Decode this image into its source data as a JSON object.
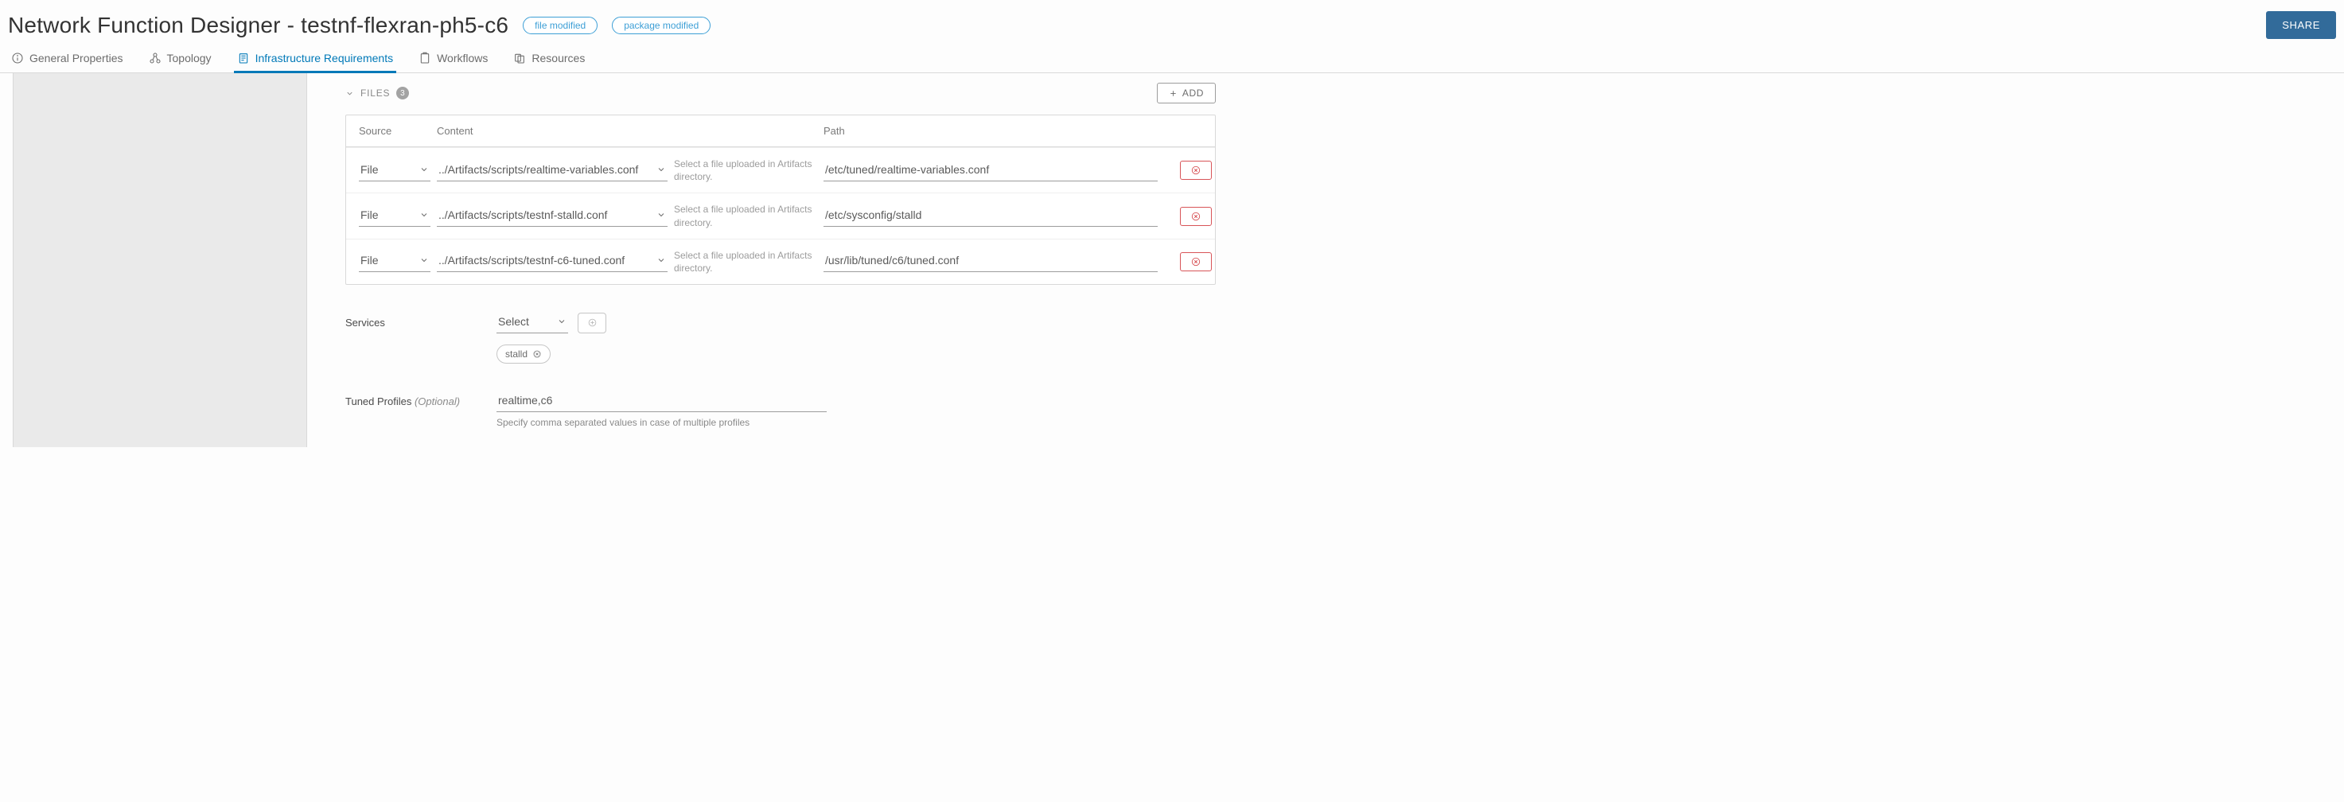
{
  "header": {
    "title": "Network Function Designer - testnf-flexran-ph5-c6",
    "badges": [
      "file modified",
      "package modified"
    ],
    "share_label": "SHARE"
  },
  "tabs": [
    {
      "label": "General Properties"
    },
    {
      "label": "Topology"
    },
    {
      "label": "Infrastructure Requirements"
    },
    {
      "label": "Workflows"
    },
    {
      "label": "Resources"
    }
  ],
  "files": {
    "section_label": "FILES",
    "count": "3",
    "add_label": "ADD",
    "columns": {
      "source": "Source",
      "content": "Content",
      "path": "Path"
    },
    "hint": "Select a file uploaded in Artifacts directory.",
    "rows": [
      {
        "source": "File",
        "content": "../Artifacts/scripts/realtime-variables.conf",
        "path": "/etc/tuned/realtime-variables.conf"
      },
      {
        "source": "File",
        "content": "../Artifacts/scripts/testnf-stalld.conf",
        "path": "/etc/sysconfig/stalld"
      },
      {
        "source": "File",
        "content": "../Artifacts/scripts/testnf-c6-tuned.conf",
        "path": "/usr/lib/tuned/c6/tuned.conf"
      }
    ]
  },
  "services": {
    "label": "Services",
    "select_placeholder": "Select",
    "tags": [
      "stalld"
    ]
  },
  "tuned": {
    "label": "Tuned Profiles",
    "optional": "(Optional)",
    "value": "realtime,c6",
    "help": "Specify comma separated values in case of multiple profiles"
  }
}
